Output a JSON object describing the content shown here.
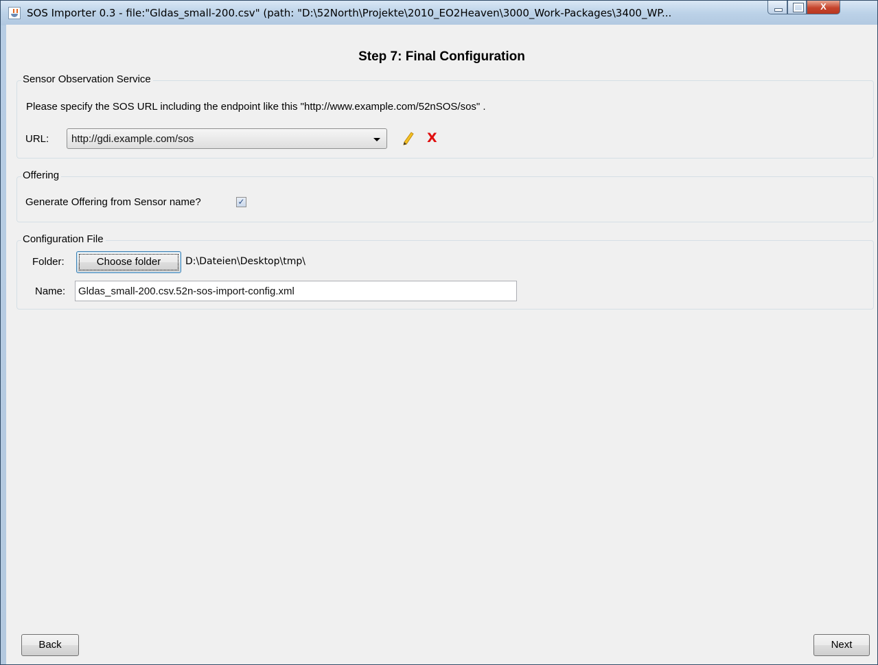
{
  "window": {
    "title": "SOS Importer 0.3 - file:\"Gldas_small-200.csv\" (path: \"D:\\52North\\Projekte\\2010_EO2Heaven\\3000_Work-Packages\\3400_WP...",
    "icon": "java-cup-icon",
    "controls": {
      "minimize": "minimize-icon",
      "maximize": "maximize-icon",
      "close_label": "X"
    }
  },
  "step": {
    "title": "Step 7: Final Configuration"
  },
  "sos": {
    "group_title": "Sensor Observation Service",
    "description": "Please specify the SOS URL including the endpoint like this \"http://www.example.com/52nSOS/sos\" .",
    "url_label": "URL:",
    "url_value": "http://gdi.example.com/sos",
    "edit_icon": "pencil-icon",
    "delete_label": "X"
  },
  "offering": {
    "group_title": "Offering",
    "checkbox_label": "Generate Offering from Sensor name?",
    "checked": true,
    "check_mark": "✓"
  },
  "config_file": {
    "group_title": "Configuration File",
    "folder_label": "Folder:",
    "choose_button": "Choose folder",
    "folder_path": "D:\\Dateien\\Desktop\\tmp\\",
    "name_label": "Name:",
    "name_value": "Gldas_small-200.csv.52n-sos-import-config.xml"
  },
  "nav": {
    "back_label": "Back",
    "next_label": "Next"
  }
}
